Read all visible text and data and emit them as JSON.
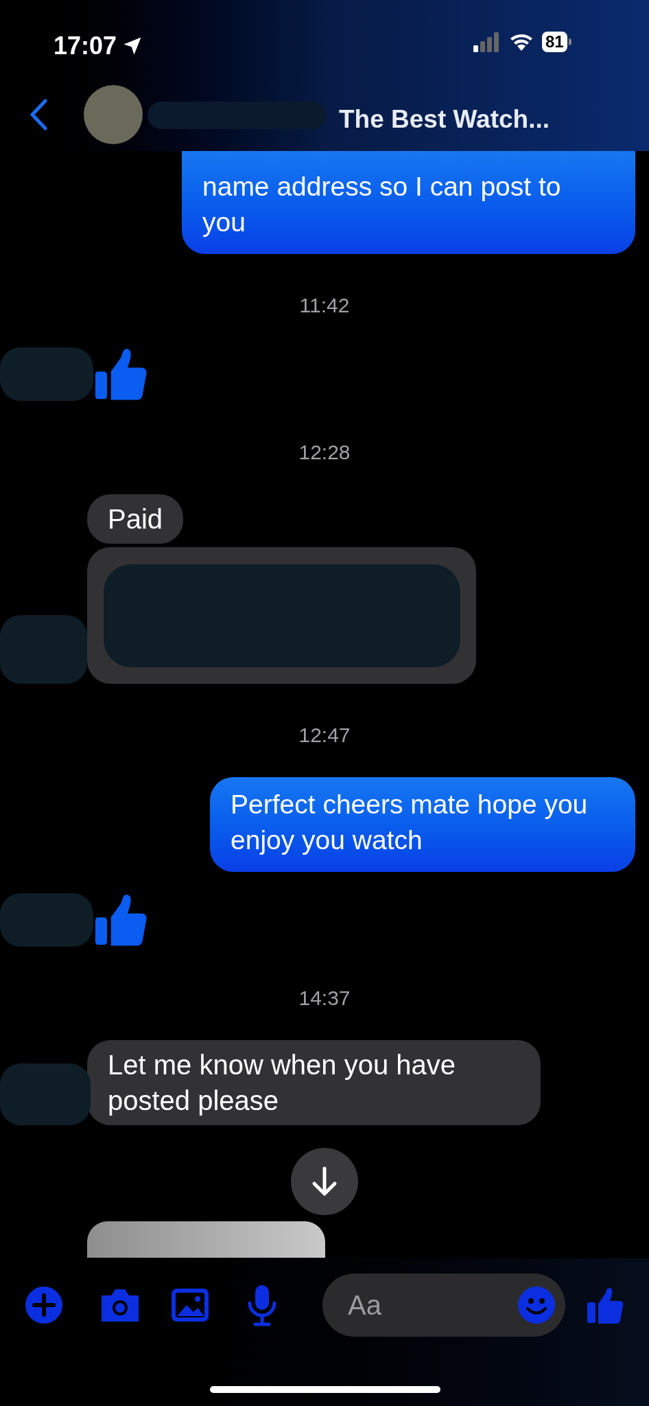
{
  "status_bar": {
    "time": "17:07",
    "battery": "81"
  },
  "header": {
    "title": "The Best Watch..."
  },
  "messages": [
    {
      "kind": "sent",
      "lines": "name address so I can post to you"
    },
    {
      "kind": "timestamp",
      "text": "11:42"
    },
    {
      "kind": "reaction"
    },
    {
      "kind": "timestamp",
      "text": "12:28"
    },
    {
      "kind": "received",
      "lines": "Paid"
    },
    {
      "kind": "redacted"
    },
    {
      "kind": "timestamp",
      "text": "12:47"
    },
    {
      "kind": "sent",
      "lines": "Perfect cheers mate hope you enjoy you watch"
    },
    {
      "kind": "reaction"
    },
    {
      "kind": "timestamp",
      "text": "14:37"
    },
    {
      "kind": "received",
      "lines": "Let me know when you have posted please"
    },
    {
      "kind": "image"
    }
  ],
  "composer": {
    "placeholder": "Aa"
  }
}
